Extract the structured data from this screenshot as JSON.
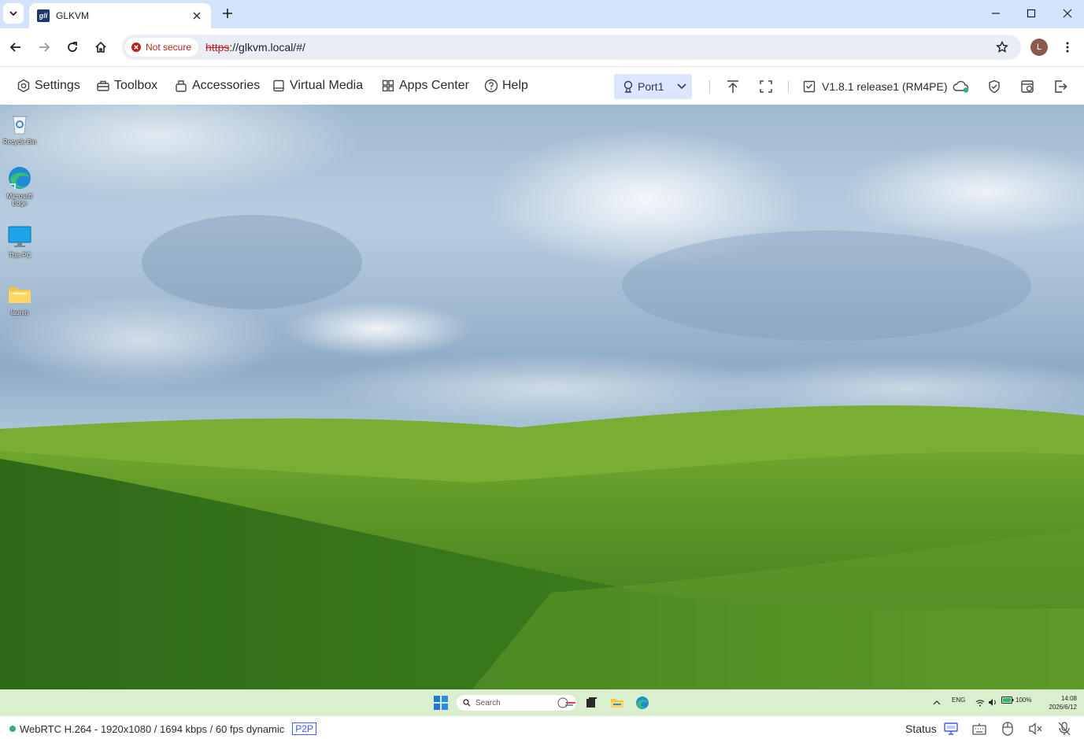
{
  "browser": {
    "tab_title": "GLKVM",
    "favicon_text": "gli",
    "address": {
      "security_label": "Not secure",
      "url_scheme": "https",
      "url_rest": "://glkvm.local/#/"
    },
    "profile_initial": "L"
  },
  "kvm_menu": {
    "items": [
      {
        "label": "Settings",
        "icon": "gear-icon"
      },
      {
        "label": "Toolbox",
        "icon": "toolbox-icon"
      },
      {
        "label": "Accessories",
        "icon": "accessories-icon"
      },
      {
        "label": "Virtual Media",
        "icon": "virtual-media-icon"
      },
      {
        "label": "Apps Center",
        "icon": "apps-grid-icon"
      },
      {
        "label": "Help",
        "icon": "help-icon"
      }
    ],
    "port": "Port1",
    "version": "V1.8.1 release1 (RM4PE)"
  },
  "desktop": {
    "icons": [
      {
        "label": "Recycle Bin",
        "icon": "recycle-bin-icon"
      },
      {
        "label": "Microsoft Edge",
        "icon": "edge-icon"
      },
      {
        "label": "This PC",
        "icon": "monitor-icon"
      },
      {
        "label": "lauren",
        "icon": "folder-icon"
      }
    ]
  },
  "taskbar": {
    "search_placeholder": "Search",
    "language": "ENG",
    "battery": "100%",
    "time": "14:08",
    "date": "2026/6/12"
  },
  "status": {
    "stream_info": "WebRTC H.264 - 1920x1080 / 1694 kbps / 60 fps dynamic",
    "mode_badge": "P2P",
    "status_label": "Status"
  },
  "colors": {
    "accent": "#3d5afe",
    "tab_strip": "#d3e3fd",
    "port_select_bg": "#dde6ff",
    "status_dot": "#2bb673",
    "not_secure": "#b3261e"
  }
}
